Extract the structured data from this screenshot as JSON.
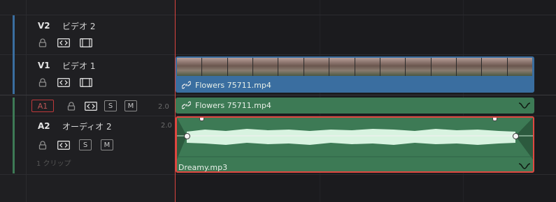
{
  "tracks": {
    "v2": {
      "label": "V2",
      "name": "ビデオ 2"
    },
    "v1": {
      "label": "V1",
      "name": "ビデオ 1"
    },
    "a1": {
      "label": "A1",
      "level": "2.0",
      "solo": "S",
      "mute": "M"
    },
    "a2": {
      "label": "A2",
      "name": "オーディオ 2",
      "level": "2.0",
      "solo": "S",
      "mute": "M",
      "clip_count": "1 クリップ"
    }
  },
  "clips": {
    "video_v1": {
      "name": "Flowers 75711.mp4"
    },
    "audio_a1": {
      "name": "Flowers 75711.mp4"
    },
    "audio_a2": {
      "name": "Dreamy.mp3"
    }
  },
  "colors": {
    "video_track": "#3a6ea0",
    "audio_track": "#3d7a55",
    "playhead": "#d9433f",
    "selected_clip": "#e04840"
  }
}
